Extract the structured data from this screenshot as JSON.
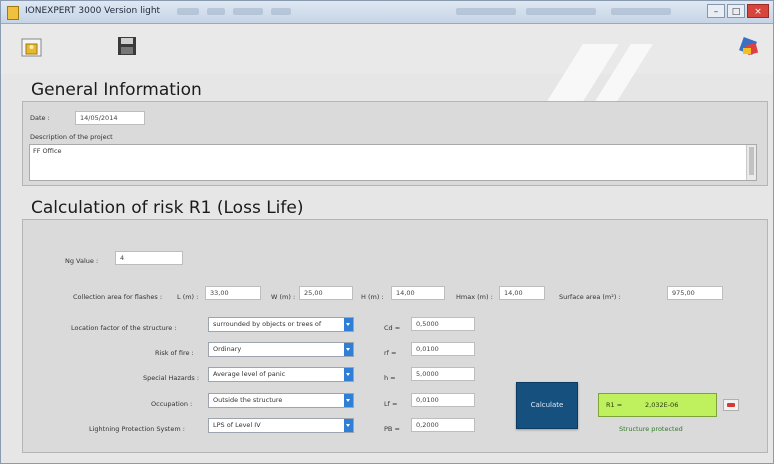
{
  "window": {
    "title": "IONEXPERT 3000 Version light",
    "menu_count": 4
  },
  "toolbar": {
    "folder_icon": "folder-icon",
    "disk_icon": "save-disk-icon",
    "tools_icon": "tools-icon"
  },
  "general": {
    "section_title": "General Information",
    "date_label": "Date :",
    "date_value": "14/05/2014",
    "description_label": "Description of the project",
    "description_value": "FF Office"
  },
  "risk": {
    "section_title": "Calculation of risk R1 (Loss Life)",
    "ng_label": "Ng Value :",
    "ng_value": "4",
    "collection_label": "Collection area for flashes :",
    "l_label": "L (m) :",
    "l_value": "33,00",
    "w_label": "W (m) :",
    "w_value": "25,00",
    "h_label": "H (m) :",
    "h_value": "14,00",
    "hmax_label": "Hmax (m) :",
    "hmax_value": "14,00",
    "surface_label": "Surface area (m²) :",
    "surface_value": "975,00",
    "location_label": "Location factor of the structure :",
    "location_value": "surrounded by objects or trees of",
    "cd_label": "Cd =",
    "cd_value": "0,5000",
    "fire_label": "Risk of fire :",
    "fire_value": "Ordinary",
    "rf_label": "rf =",
    "rf_value": "0,0100",
    "hazards_label": "Special Hazards :",
    "hazards_value": "Average level of panic",
    "h2_label": "h =",
    "h2_value": "5,0000",
    "occupation_label": "Occupation :",
    "occupation_value": "Outside the structure",
    "lf_label": "Lf =",
    "lf_value": "0,0100",
    "lps_label": "Lightning Protection System :",
    "lps_value": "LPS of Level IV",
    "pb_label": "PB =",
    "pb_value": "0,2000",
    "calc_button": "Calculate",
    "r1_label": "R1 =",
    "r1_value": "2,032E-06",
    "status": "Structure protected"
  },
  "colors": {
    "calc_button": "#16507f",
    "result_bg": "#bff05d",
    "status_green": "#2f7a25",
    "combo_button": "#2f7fd6"
  }
}
